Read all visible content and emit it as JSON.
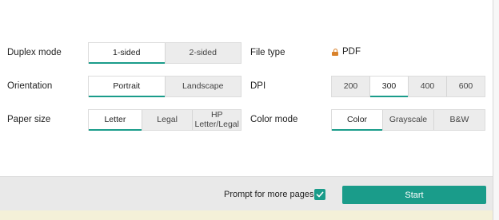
{
  "settings": {
    "duplex": {
      "label": "Duplex mode",
      "options": [
        "1-sided",
        "2-sided"
      ],
      "selected": "1-sided"
    },
    "orientation": {
      "label": "Orientation",
      "options": [
        "Portrait",
        "Landscape"
      ],
      "selected": "Portrait"
    },
    "paper_size": {
      "label": "Paper size",
      "options": [
        "Letter",
        "Legal",
        "HP Letter/Legal"
      ],
      "selected": "Letter"
    },
    "file_type": {
      "label": "File type",
      "value": "PDF",
      "icon": "lock-icon"
    },
    "dpi": {
      "label": "DPI",
      "options": [
        "200",
        "300",
        "400",
        "600"
      ],
      "selected": "300"
    },
    "color_mode": {
      "label": "Color mode",
      "options": [
        "Color",
        "Grayscale",
        "B&W"
      ],
      "selected": "Color"
    }
  },
  "footer": {
    "prompt_label": "Prompt for more pages",
    "prompt_checked": true,
    "start_label": "Start"
  },
  "colors": {
    "accent": "#1a9c8a",
    "lock": "#d9822b"
  }
}
